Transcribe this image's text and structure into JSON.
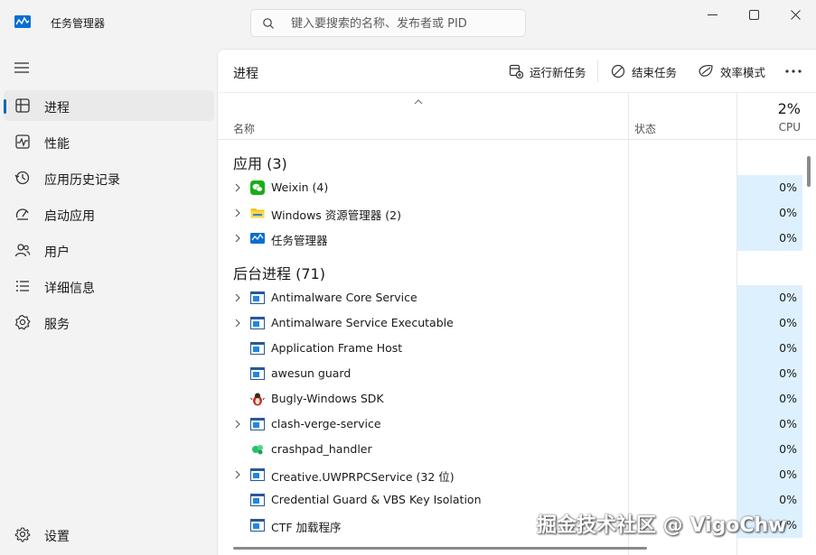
{
  "window": {
    "title": "任务管理器",
    "app_icon": "task-manager-icon",
    "controls": [
      "minimize-icon",
      "maximize-icon",
      "close-icon"
    ]
  },
  "search": {
    "placeholder": "键入要搜索的名称、发布者或 PID",
    "value": ""
  },
  "sidebar": {
    "menu_icon": "hamburger-icon",
    "items": [
      {
        "label": "进程",
        "icon": "processes-icon",
        "active": true
      },
      {
        "label": "性能",
        "icon": "performance-icon",
        "active": false
      },
      {
        "label": "应用历史记录",
        "icon": "history-icon",
        "active": false
      },
      {
        "label": "启动应用",
        "icon": "startup-icon",
        "active": false
      },
      {
        "label": "用户",
        "icon": "users-icon",
        "active": false
      },
      {
        "label": "详细信息",
        "icon": "details-icon",
        "active": false
      },
      {
        "label": "服务",
        "icon": "services-icon",
        "active": false
      }
    ],
    "settings": {
      "label": "设置",
      "icon": "gear-icon"
    }
  },
  "toolbar": {
    "title": "进程",
    "run_task": "运行新任务",
    "end_task": "结束任务",
    "efficiency": "效率模式",
    "more_icon": "more-icon"
  },
  "table": {
    "headers": {
      "name": "名称",
      "status": "状态",
      "cpu_total": "2%",
      "cpu": "CPU"
    },
    "groups": [
      {
        "label": "应用 (3)",
        "rows": [
          {
            "name": "Weixin (4)",
            "icon": "wechat-icon",
            "expandable": true,
            "cpu": "0%"
          },
          {
            "name": "Windows 资源管理器 (2)",
            "icon": "folder-icon",
            "expandable": true,
            "cpu": "0%"
          },
          {
            "name": "任务管理器",
            "icon": "task-manager-icon",
            "expandable": true,
            "cpu": "0%"
          }
        ]
      },
      {
        "label": "后台进程 (71)",
        "rows": [
          {
            "name": "Antimalware Core Service",
            "icon": "service-icon",
            "expandable": true,
            "cpu": "0%"
          },
          {
            "name": "Antimalware Service Executable",
            "icon": "service-icon",
            "expandable": true,
            "cpu": "0%"
          },
          {
            "name": "Application Frame Host",
            "icon": "service-icon",
            "expandable": false,
            "cpu": "0%"
          },
          {
            "name": "awesun guard",
            "icon": "service-icon",
            "expandable": false,
            "cpu": "0%"
          },
          {
            "name": "Bugly-Windows SDK",
            "icon": "bug-icon",
            "expandable": false,
            "cpu": "0%"
          },
          {
            "name": "clash-verge-service",
            "icon": "service-icon",
            "expandable": true,
            "cpu": "0%"
          },
          {
            "name": "crashpad_handler",
            "icon": "green-logo-icon",
            "expandable": false,
            "cpu": "0%"
          },
          {
            "name": "Creative.UWPRPCService (32 位)",
            "icon": "service-icon",
            "expandable": true,
            "cpu": "0%"
          },
          {
            "name": "Credential Guard & VBS Key Isolation",
            "icon": "service-icon",
            "expandable": false,
            "cpu": "0%"
          },
          {
            "name": "CTF 加载程序",
            "icon": "service-icon",
            "expandable": false,
            "cpu": "0%"
          }
        ]
      }
    ]
  },
  "watermark": "掘金技术社区 @ VigoChw",
  "colors": {
    "accent": "#0067c0",
    "cpu_cell_bg": "#ddf0fe",
    "window_bg": "#f3f3f3",
    "panel_bg": "#ffffff"
  }
}
